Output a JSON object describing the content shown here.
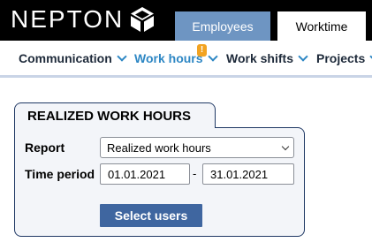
{
  "brand": {
    "name": "NEPTON",
    "logo_icon": "cube-icon"
  },
  "top_tabs": [
    {
      "label": "Employees",
      "active": false
    },
    {
      "label": "Worktime",
      "active": true
    }
  ],
  "nav": {
    "items": [
      {
        "label": "Communication",
        "active": false
      },
      {
        "label": "Work hours",
        "active": true,
        "badge": "!"
      },
      {
        "label": "Work shifts",
        "active": false
      },
      {
        "label": "Projects",
        "active": false
      }
    ]
  },
  "colors": {
    "topbar": "#000000",
    "employees_tab": "#6e95c2",
    "active_nav": "#2e87c4",
    "badge": "#f2a321",
    "panel_border": "#1f3864",
    "button": "#3f66a0"
  },
  "panel": {
    "title": "REALIZED WORK HOURS",
    "report_label": "Report",
    "report_value": "Realized work hours",
    "time_period_label": "Time period",
    "date_from": "01.01.2021",
    "date_separator": "-",
    "date_to": "31.01.2021",
    "select_users_label": "Select users"
  }
}
